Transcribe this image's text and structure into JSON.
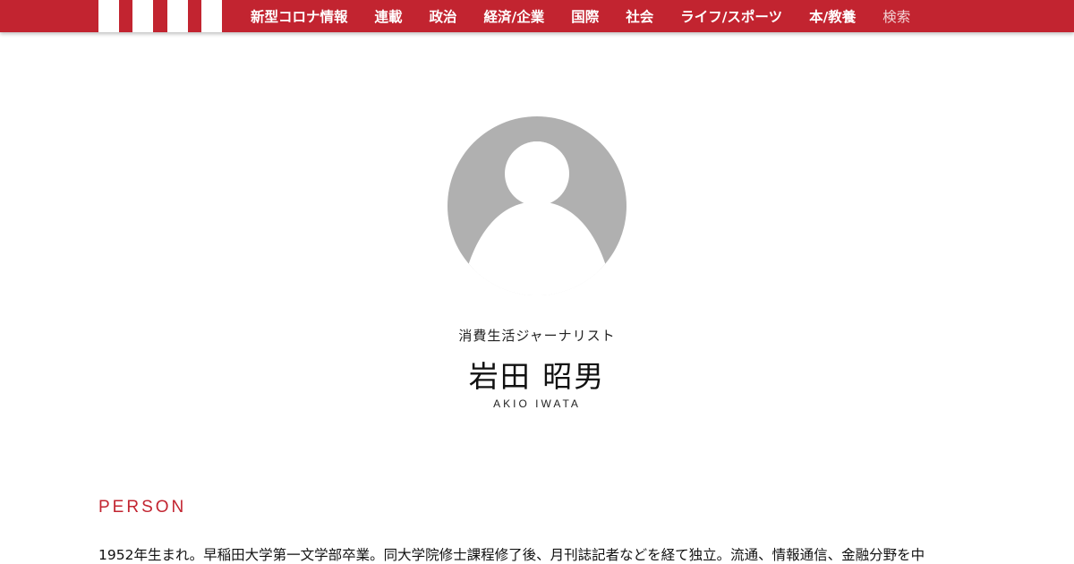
{
  "header": {
    "nav": [
      "新型コロナ情報",
      "連載",
      "政治",
      "経済/企業",
      "国際",
      "社会",
      "ライフ/スポーツ",
      "本/教養"
    ],
    "search_label": "検索",
    "brand_color": "#c22430",
    "logo_icon": "striped-logo-icon"
  },
  "profile": {
    "avatar_icon": "default-user-avatar-icon",
    "role": "消費生活ジャーナリスト",
    "name": "岩田 昭男",
    "name_roman": "AKIO IWATA"
  },
  "person_section": {
    "heading": "PERSON",
    "bio": "1952年生まれ。早稲田大学第一文学部卒業。同大学院修士課程修了後、月刊誌記者などを経て独立。流通、情報通信、金融分野を中"
  }
}
